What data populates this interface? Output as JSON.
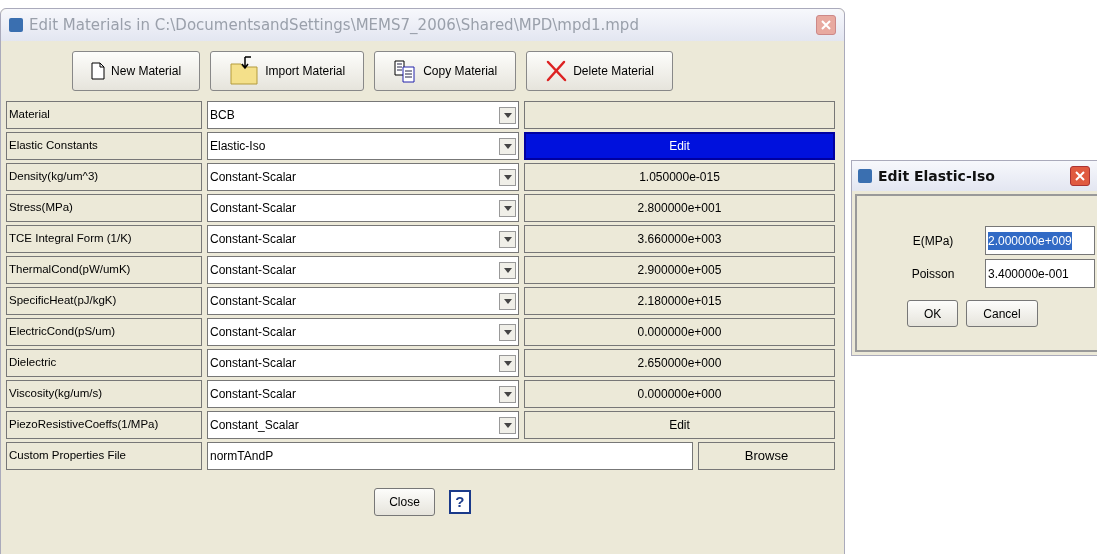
{
  "window": {
    "title": "Edit Materials in C:\\DocumentsandSettings\\MEMS7_2006\\Shared\\MPD\\mpd1.mpd"
  },
  "toolbar": [
    {
      "label": "New Material",
      "kind": "new"
    },
    {
      "label": "Import Material",
      "kind": "import"
    },
    {
      "label": "Copy Material",
      "kind": "copy"
    },
    {
      "label": "Delete Material",
      "kind": "delete"
    }
  ],
  "rows": [
    {
      "kind": "select",
      "label": "Material",
      "type": "BCB",
      "value": "",
      "selected": false
    },
    {
      "kind": "select",
      "label": "Elastic Constants",
      "type": "Elastic-Iso",
      "value": "Edit",
      "selected": true
    },
    {
      "kind": "select",
      "label": "Density(kg/um^3)",
      "type": "Constant-Scalar",
      "value": "1.050000e-015",
      "selected": false
    },
    {
      "kind": "select",
      "label": "Stress(MPa)",
      "type": "Constant-Scalar",
      "value": "2.800000e+001",
      "selected": false
    },
    {
      "kind": "select",
      "label": "TCE Integral Form (1/K)",
      "type": "Constant-Scalar",
      "value": "3.660000e+003",
      "selected": false
    },
    {
      "kind": "select",
      "label": "ThermalCond(pW/umK)",
      "type": "Constant-Scalar",
      "value": "2.900000e+005",
      "selected": false
    },
    {
      "kind": "select",
      "label": "SpecificHeat(pJ/kgK)",
      "type": "Constant-Scalar",
      "value": "2.180000e+015",
      "selected": false
    },
    {
      "kind": "select",
      "label": "ElectricCond(pS/um)",
      "type": "Constant-Scalar",
      "value": "0.000000e+000",
      "selected": false
    },
    {
      "kind": "select",
      "label": "Dielectric",
      "type": "Constant-Scalar",
      "value": "2.650000e+000",
      "selected": false
    },
    {
      "kind": "select",
      "label": "Viscosity(kg/um/s)",
      "type": "Constant-Scalar",
      "value": "0.000000e+000",
      "selected": false
    },
    {
      "kind": "select",
      "label": "PiezoResistiveCoeffs(1/MPa)",
      "type": "Constant_Scalar",
      "value": "Edit",
      "selected": false
    },
    {
      "kind": "file",
      "label": "Custom Properties File",
      "type": "normTAndP",
      "value": "Browse",
      "selected": false
    }
  ],
  "footer": {
    "close": "Close",
    "help": "?"
  },
  "dialog": {
    "title": "Edit Elastic-Iso",
    "fields": [
      {
        "label": "E(MPa)",
        "value": "2.000000e+009",
        "selected": true
      },
      {
        "label": "Poisson",
        "value": "3.400000e-001",
        "selected": false
      }
    ],
    "buttons": [
      "OK",
      "Cancel"
    ]
  }
}
